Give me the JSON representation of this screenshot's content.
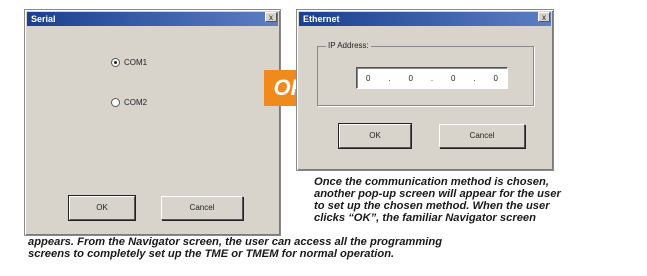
{
  "serial_dialog": {
    "title": "Serial",
    "close_glyph": "x",
    "options": [
      {
        "label": "COM1",
        "selected": true
      },
      {
        "label": "COM2",
        "selected": false
      }
    ],
    "ok_label": "OK",
    "cancel_label": "Cancel"
  },
  "or_label": "OR",
  "ethernet_dialog": {
    "title": "Ethernet",
    "close_glyph": "x",
    "group_label": "IP Address:",
    "ip_octets": [
      "0",
      "0",
      "0",
      "0"
    ],
    "ok_label": "OK",
    "cancel_label": "Cancel"
  },
  "caption": {
    "lines": [
      "Once the communication method is chosen,",
      "another pop-up screen will appear for the user",
      "to set up the chosen method. When the user",
      "clicks “OK”, the familiar Navigator screen",
      "appears. From the Navigator screen, the user can access all the programming",
      "screens to completely set up the TME or TMEM for normal operation."
    ]
  },
  "colors": {
    "or_badge": "#f08a1c",
    "dialog_face": "#d8d4cc",
    "title_bar": "#1b3f8f"
  }
}
